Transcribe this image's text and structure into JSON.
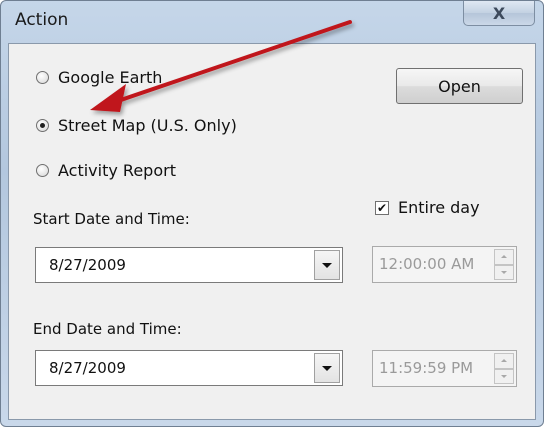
{
  "window": {
    "title": "Action",
    "close_glyph": "X"
  },
  "options": [
    {
      "label": "Google Earth",
      "selected": false
    },
    {
      "label": "Street Map (U.S. Only)",
      "selected": true
    },
    {
      "label": "Activity Report",
      "selected": false
    }
  ],
  "open_button": {
    "label": "Open"
  },
  "entire_day": {
    "label": "Entire day",
    "checked": true,
    "check_glyph": "✔"
  },
  "start": {
    "label": "Start Date and Time:",
    "date": "8/27/2009",
    "time": "12:00:00 AM"
  },
  "end": {
    "label": "End Date and Time:",
    "date": "8/27/2009",
    "time": "11:59:59 PM"
  },
  "colors": {
    "annotation_arrow": "#c0161b",
    "title_bar": "#b3c7de",
    "client_bg": "#f0f0f0"
  }
}
